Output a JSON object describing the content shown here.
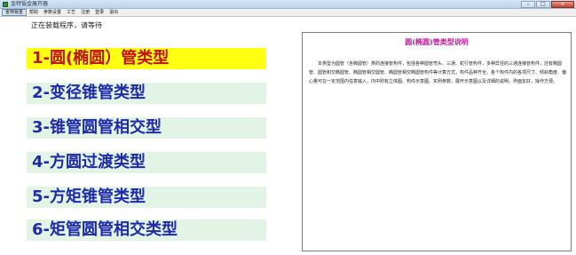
{
  "window": {
    "title": "金特钣金展开器",
    "buttons": {
      "minimize": "–",
      "maximize": "□",
      "close": "×"
    }
  },
  "menu": {
    "items": [
      "金特钣金",
      "帮助",
      "参数设置",
      "工艺",
      "注册",
      "登录",
      "退出"
    ]
  },
  "status": {
    "loading_text": "正在装载程序，请等待"
  },
  "types": [
    {
      "label": "1-圆(椭圆）管类型",
      "selected": true
    },
    {
      "label": "2-变径锥管类型",
      "selected": false
    },
    {
      "label": "3-锥管圆管相交型",
      "selected": false
    },
    {
      "label": "4-方圆过渡类型",
      "selected": false
    },
    {
      "label": "5-方矩锥管类型",
      "selected": false
    },
    {
      "label": "6-矩管圆管相交类型",
      "selected": false
    }
  ],
  "panel": {
    "title": "圆(椭圆)管类型说明",
    "description": "本类型为圆管（含椭圆管）类的连接管构件，包括各种圆管弯头、三通、蛇行管构件，多种异径的三通连接管构件，还有椭圆管、圆管和交椭圆管、椭圆管相交圆管、椭圆管相交椭圆管构件等计算方式，构件品种齐全。各个构件内的各项尺寸、倾斜角度、偏心量可在一定范围内任意输入，内中附有立体图、构件示意图、实例参数，展开示意图以及详细的说明，界面友好，操作方便。"
  },
  "colors": {
    "selected_bg": "#ffff12",
    "selected_text": "#c0121a",
    "button_bg": "#e1f4e5",
    "button_text": "#1f2aa8",
    "panel_title": "#c01a9a"
  }
}
